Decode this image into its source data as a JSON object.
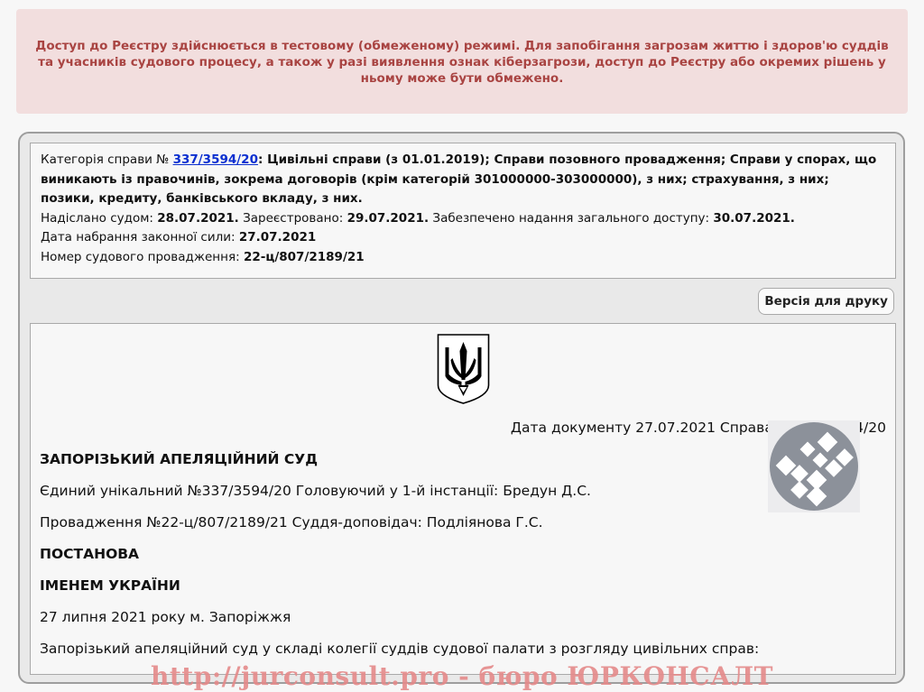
{
  "warning_text": "Доступ до Реєстру здійснюється в тестовому (обмеженому) режимі. Для запобігання загрозам життю і здоров'ю суддів та учасників судового процесу, а також у разі виявлення ознак кіберзагрози, доступ до Реєстру або окремих рішень у ньому може бути обмежено.",
  "info": {
    "category_label": "Категорія справи № ",
    "case_number": "337/3594/20",
    "category_value": ": Цивільні справи (з 01.01.2019); Справи позовного провадження; Справи у спорах, що виникають із правочинів, зокрема договорів (крім категорій 301000000-303000000), з них; страхування, з них; позики, кредиту, банківського вкладу, з них.",
    "sent_label": "Надіслано судом: ",
    "sent_value": "28.07.2021.",
    "registered_label": " Зареєстровано: ",
    "registered_value": "29.07.2021.",
    "access_label": " Забезпечено надання загального доступу: ",
    "access_value": "30.07.2021.",
    "force_label": "Дата набрання законної сили: ",
    "force_value": "27.07.2021",
    "proceeding_label": "Номер судового провадження: ",
    "proceeding_value": "22-ц/807/2189/21"
  },
  "print_button": "Версія для друку",
  "document": {
    "date_line": "Дата документу 27.07.2021 Справа № 337/3594/20",
    "court": "ЗАПОРІЗЬКИЙ АПЕЛЯЦІЙНИЙ СУД",
    "unique_line": "Єдиний унікальний №337/3594/20 Головуючий у 1-й інстанції: Бредун Д.С.",
    "proceeding_line": "Провадження №22-ц/807/2189/21 Суддя-доповідач: Подліянова Г.С.",
    "resolution": "ПОСТАНОВА",
    "in_name": "ІМЕНЕМ УКРАЇНИ",
    "date_place": "27 липня 2021 року м. Запоріжжя",
    "intro": "Запорізький апеляційний суд у складі колегії суддів судової палати з розгляду цивільних справ:"
  },
  "watermark": "http://jurconsult.pro - бюро ЮРКОНСАЛТ",
  "colors": {
    "warning_bg": "#f2dede",
    "warning_text": "#a94442",
    "link": "#0b2fd0",
    "badge": "#8c919a"
  },
  "icons": {
    "emblem": "trident-coat-of-arms-icon",
    "badge": "dots-badge-icon"
  }
}
